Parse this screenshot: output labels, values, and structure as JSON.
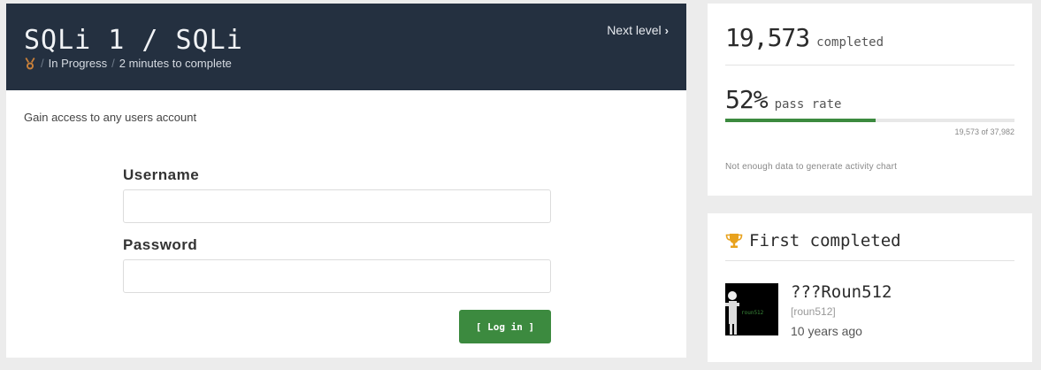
{
  "challenge": {
    "title": "SQLi 1 / SQLi",
    "status": "In Progress",
    "duration": "2 minutes to complete",
    "next_label": "Next level",
    "description": "Gain access to any users account"
  },
  "form": {
    "username_label": "Username",
    "password_label": "Password",
    "username_value": "",
    "password_value": "",
    "login_label": "[ Log in ]"
  },
  "stats": {
    "completed_count": "19,573",
    "completed_label": "completed",
    "pass_rate_value": "52%",
    "pass_rate_label": "pass rate",
    "pass_fraction": 0.52,
    "pass_caption": "19,573 of 37,982",
    "activity_note": "Not enough data to generate activity chart"
  },
  "first_completed": {
    "heading": "First completed",
    "username": "???Roun512",
    "handle": "[roun512]",
    "time_ago": "10 years ago",
    "avatar_text": "roun512"
  },
  "colors": {
    "header_bg": "#243040",
    "accent_green": "#3c8a3f",
    "medal": "#c9803a",
    "trophy": "#e8a21e"
  },
  "icons": {
    "medal": "medal-icon",
    "chevron": "chevron-right-icon",
    "trophy": "trophy-icon"
  }
}
